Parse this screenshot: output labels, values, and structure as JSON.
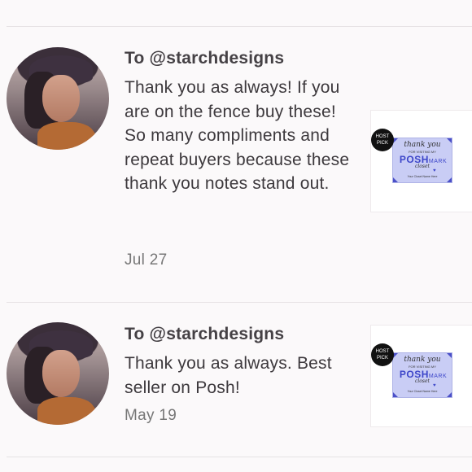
{
  "reviews": [
    {
      "recipient": "To @starchdesigns",
      "message": "Thank you as always! If you are on the fence buy these! So many compliments and repeat buyers because these thank you notes stand out.",
      "date": "Jul 27",
      "badge": {
        "line1": "HOST",
        "line2": "PICK"
      },
      "card": {
        "script": "thank you",
        "small": "FOR VISITING MY",
        "posh": "POSH",
        "mark": "MARK",
        "script2": "closet",
        "closet": "Your Closet Name Here"
      }
    },
    {
      "recipient": "To @starchdesigns",
      "message": "Thank you as always. Best seller on Posh!",
      "date": "May 19",
      "badge": {
        "line1": "HOST",
        "line2": "PICK"
      },
      "card": {
        "script": "thank you",
        "small": "FOR VISITING MY",
        "posh": "POSH",
        "mark": "MARK",
        "script2": "closet",
        "closet": "Your Closet Name Here"
      }
    }
  ],
  "colors": {
    "accent": "#3d46c9",
    "card_bg": "#c9cdf5",
    "badge_bg": "#111111"
  }
}
